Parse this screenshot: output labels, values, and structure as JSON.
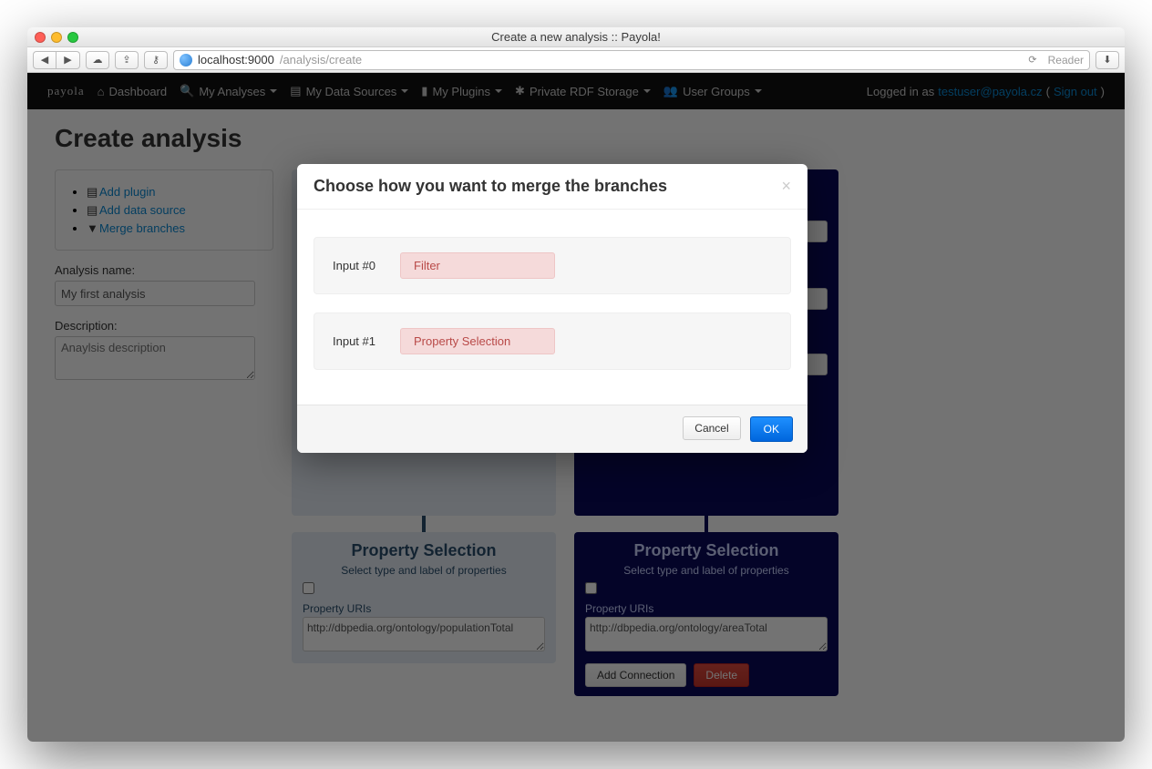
{
  "window_title": "Create a new analysis :: Payola!",
  "url": {
    "host": "localhost:9000",
    "path": "/analysis/create"
  },
  "toolbar": {
    "reader": "Reader"
  },
  "nav": {
    "brand": "payola",
    "items": [
      "Dashboard",
      "My Analyses",
      "My Data Sources",
      "My Plugins",
      "Private RDF Storage",
      "User Groups"
    ],
    "logged_prefix": "Logged in as ",
    "user": "testuser@payola.cz",
    "signout": "Sign out"
  },
  "page": {
    "title": "Create analysis",
    "side": {
      "add_plugin": "Add plugin",
      "add_ds": "Add data source",
      "merge": "Merge branches",
      "name_label": "Analysis name:",
      "name_value": "My first analysis",
      "desc_label": "Description:",
      "desc_placeholder": "Anaylsis description"
    },
    "nodes": {
      "ps1": {
        "title": "Property Selection",
        "sub": "Select type and label of properties",
        "uris_label": "Property URIs",
        "uris_value": "http://dbpedia.org/ontology/populationTotal"
      },
      "ps2": {
        "title": "Property Selection",
        "sub": "Select type and label of properties",
        "uris_label": "Property URIs",
        "uris_value": "http://dbpedia.org/ontology/areaTotal",
        "add_conn": "Add Connection",
        "delete": "Delete"
      }
    }
  },
  "modal": {
    "title": "Choose how you want to merge the branches",
    "inputs": [
      {
        "label": "Input #0",
        "value": "Filter"
      },
      {
        "label": "Input #1",
        "value": "Property Selection"
      }
    ],
    "cancel": "Cancel",
    "ok": "OK"
  }
}
